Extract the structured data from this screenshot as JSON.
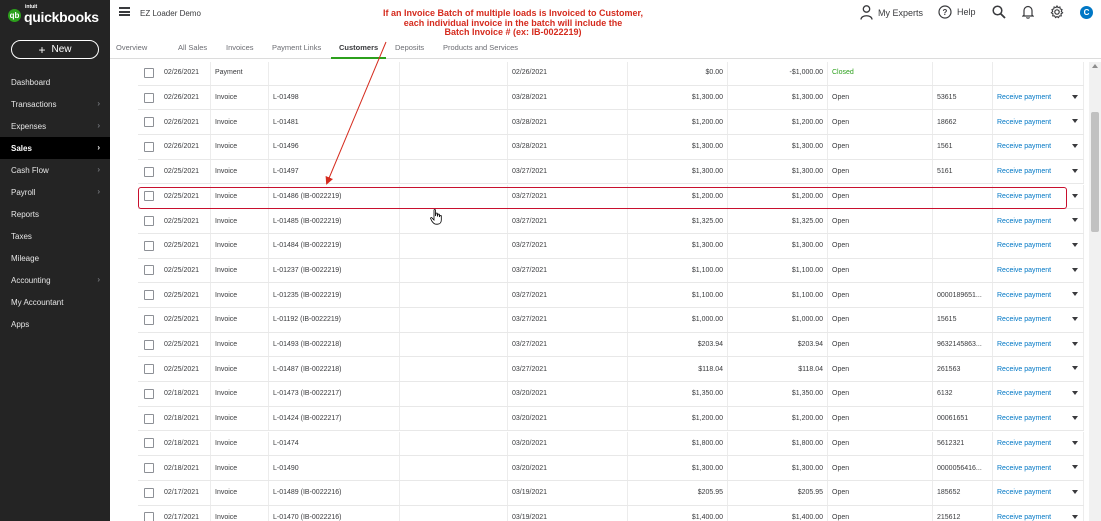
{
  "app": {
    "logo_small": "intuit",
    "logo_text": "quickbooks",
    "new_label": "New",
    "company": "EZ Loader Demo"
  },
  "sidebar": {
    "items": [
      {
        "label": "Dashboard",
        "chevron": false,
        "active": false
      },
      {
        "label": "Transactions",
        "chevron": true,
        "active": false
      },
      {
        "label": "Expenses",
        "chevron": true,
        "active": false
      },
      {
        "label": "Sales",
        "chevron": true,
        "active": true
      },
      {
        "label": "Cash Flow",
        "chevron": true,
        "active": false
      },
      {
        "label": "Payroll",
        "chevron": true,
        "active": false
      },
      {
        "label": "Reports",
        "chevron": false,
        "active": false
      },
      {
        "label": "Taxes",
        "chevron": false,
        "active": false
      },
      {
        "label": "Mileage",
        "chevron": false,
        "active": false
      },
      {
        "label": "Accounting",
        "chevron": true,
        "active": false
      },
      {
        "label": "My Accountant",
        "chevron": false,
        "active": false
      },
      {
        "label": "Apps",
        "chevron": false,
        "active": false
      }
    ]
  },
  "header": {
    "my_experts": "My Experts",
    "help": "Help",
    "avatar_letter": "C"
  },
  "tabs": [
    {
      "label": "Overview",
      "active": false
    },
    {
      "label": "All Sales",
      "active": false
    },
    {
      "label": "Invoices",
      "active": false
    },
    {
      "label": "Payment Links",
      "active": false
    },
    {
      "label": "Customers",
      "active": true
    },
    {
      "label": "Deposits",
      "active": false
    },
    {
      "label": "Products and Services",
      "active": false
    }
  ],
  "annotation": {
    "lines": [
      "If an Invoice Batch of multiple loads is Invoiced to Customer,",
      "each individual invoice in the batch will include the",
      "Batch Invoice # (ex: IB-0022219)"
    ]
  },
  "table": {
    "action_label": "Receive payment",
    "rows": [
      {
        "date": "02/26/2021",
        "type": "Payment",
        "no": "",
        "due": "02/26/2021",
        "balance": "$0.00",
        "total": "-$1,000.00",
        "status": "Closed",
        "ref": "",
        "action": false
      },
      {
        "date": "02/26/2021",
        "type": "Invoice",
        "no": "L-01498",
        "due": "03/28/2021",
        "balance": "$1,300.00",
        "total": "$1,300.00",
        "status": "Open",
        "ref": "53615",
        "action": true
      },
      {
        "date": "02/26/2021",
        "type": "Invoice",
        "no": "L-01481",
        "due": "03/28/2021",
        "balance": "$1,200.00",
        "total": "$1,200.00",
        "status": "Open",
        "ref": "18662",
        "action": true
      },
      {
        "date": "02/26/2021",
        "type": "Invoice",
        "no": "L-01496",
        "due": "03/28/2021",
        "balance": "$1,300.00",
        "total": "$1,300.00",
        "status": "Open",
        "ref": "1561",
        "action": true
      },
      {
        "date": "02/25/2021",
        "type": "Invoice",
        "no": "L-01497",
        "due": "03/27/2021",
        "balance": "$1,300.00",
        "total": "$1,300.00",
        "status": "Open",
        "ref": "5161",
        "action": true
      },
      {
        "date": "02/25/2021",
        "type": "Invoice",
        "no": "L-01486 (IB-0022219)",
        "due": "03/27/2021",
        "balance": "$1,200.00",
        "total": "$1,200.00",
        "status": "Open",
        "ref": "",
        "action": true,
        "highlight": true
      },
      {
        "date": "02/25/2021",
        "type": "Invoice",
        "no": "L-01485 (IB-0022219)",
        "due": "03/27/2021",
        "balance": "$1,325.00",
        "total": "$1,325.00",
        "status": "Open",
        "ref": "",
        "action": true
      },
      {
        "date": "02/25/2021",
        "type": "Invoice",
        "no": "L-01484 (IB-0022219)",
        "due": "03/27/2021",
        "balance": "$1,300.00",
        "total": "$1,300.00",
        "status": "Open",
        "ref": "",
        "action": true
      },
      {
        "date": "02/25/2021",
        "type": "Invoice",
        "no": "L-01237 (IB-0022219)",
        "due": "03/27/2021",
        "balance": "$1,100.00",
        "total": "$1,100.00",
        "status": "Open",
        "ref": "",
        "action": true
      },
      {
        "date": "02/25/2021",
        "type": "Invoice",
        "no": "L-01235 (IB-0022219)",
        "due": "03/27/2021",
        "balance": "$1,100.00",
        "total": "$1,100.00",
        "status": "Open",
        "ref": "0000189651...",
        "action": true
      },
      {
        "date": "02/25/2021",
        "type": "Invoice",
        "no": "L-01192 (IB-0022219)",
        "due": "03/27/2021",
        "balance": "$1,000.00",
        "total": "$1,000.00",
        "status": "Open",
        "ref": "15615",
        "action": true
      },
      {
        "date": "02/25/2021",
        "type": "Invoice",
        "no": "L-01493 (IB-0022218)",
        "due": "03/27/2021",
        "balance": "$203.94",
        "total": "$203.94",
        "status": "Open",
        "ref": "9632145863...",
        "action": true
      },
      {
        "date": "02/25/2021",
        "type": "Invoice",
        "no": "L-01487 (IB-0022218)",
        "due": "03/27/2021",
        "balance": "$118.04",
        "total": "$118.04",
        "status": "Open",
        "ref": "261563",
        "action": true
      },
      {
        "date": "02/18/2021",
        "type": "Invoice",
        "no": "L-01473 (IB-0022217)",
        "due": "03/20/2021",
        "balance": "$1,350.00",
        "total": "$1,350.00",
        "status": "Open",
        "ref": "6132",
        "action": true
      },
      {
        "date": "02/18/2021",
        "type": "Invoice",
        "no": "L-01424 (IB-0022217)",
        "due": "03/20/2021",
        "balance": "$1,200.00",
        "total": "$1,200.00",
        "status": "Open",
        "ref": "00061651",
        "action": true
      },
      {
        "date": "02/18/2021",
        "type": "Invoice",
        "no": "L-01474",
        "due": "03/20/2021",
        "balance": "$1,800.00",
        "total": "$1,800.00",
        "status": "Open",
        "ref": "5612321",
        "action": true
      },
      {
        "date": "02/18/2021",
        "type": "Invoice",
        "no": "L-01490",
        "due": "03/20/2021",
        "balance": "$1,300.00",
        "total": "$1,300.00",
        "status": "Open",
        "ref": "0000056416...",
        "action": true
      },
      {
        "date": "02/17/2021",
        "type": "Invoice",
        "no": "L-01489 (IB-0022216)",
        "due": "03/19/2021",
        "balance": "$205.95",
        "total": "$205.95",
        "status": "Open",
        "ref": "185652",
        "action": true
      },
      {
        "date": "02/17/2021",
        "type": "Invoice",
        "no": "L-01470 (IB-0022216)",
        "due": "03/19/2021",
        "balance": "$1,400.00",
        "total": "$1,400.00",
        "status": "Open",
        "ref": "215612",
        "action": true
      }
    ]
  }
}
